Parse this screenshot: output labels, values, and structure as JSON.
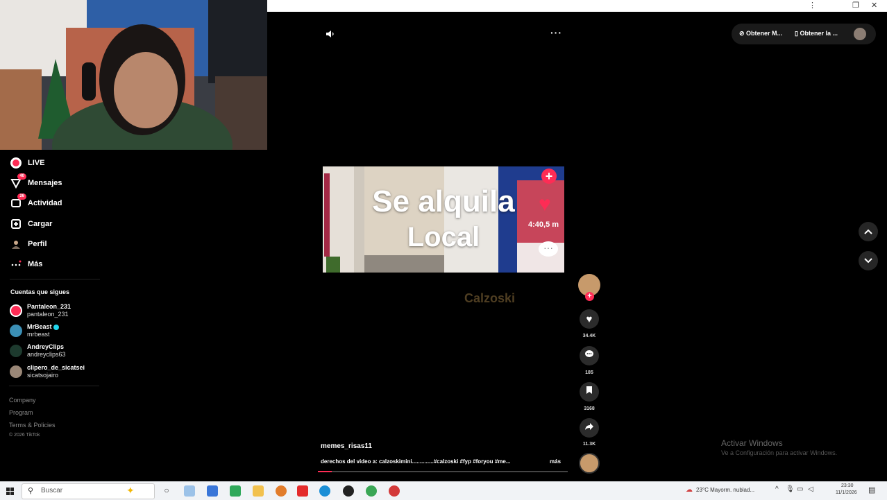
{
  "sidebar": {
    "nav": [
      {
        "label": "LIVE",
        "icon": "live-icon"
      },
      {
        "label": "Mensajes",
        "icon": "message-icon",
        "badge": "40"
      },
      {
        "label": "Actividad",
        "icon": "activity-icon",
        "badge": "26"
      },
      {
        "label": "Cargar",
        "icon": "upload-icon"
      },
      {
        "label": "Perfil",
        "icon": "profile-icon"
      },
      {
        "label": "Más",
        "icon": "more-icon"
      }
    ],
    "following_title": "Cuentas que sigues",
    "following": [
      {
        "name": "Pantaleon_231",
        "handle": "pantaleon_231"
      },
      {
        "name": "MrBeast",
        "handle": "mrbeast"
      },
      {
        "name": "AndreyClips",
        "handle": "andreyclips63"
      },
      {
        "name": "clipero_de_sicatsei",
        "handle": "sicatsojairo"
      }
    ],
    "footer": [
      "Company",
      "Program",
      "Terms & Policies",
      "© 2026 TikTok"
    ]
  },
  "header": {
    "get_app_1": "Obtener M...",
    "get_app_2": "Obtener la ..."
  },
  "video": {
    "caption_line1": "Se alquila",
    "caption_line2": "Local",
    "distance": "4:40,5 m",
    "watermark": "Calzoski",
    "author": "memes_risas11",
    "description": "derechos del video a: calzoskimini..............#calzoski #fyp #foryou #me...",
    "more_label": "más"
  },
  "actions": {
    "likes": "34.4K",
    "comments": "185",
    "saves": "3168",
    "shares": "11.3K"
  },
  "activation": {
    "title": "Activar Windows",
    "subtitle": "Ve a Configuración para activar Windows."
  },
  "taskbar": {
    "search_placeholder": "Buscar",
    "weather": "23°C  Mayorm. nublad...",
    "time": "23:30",
    "date": "11/1/2026"
  },
  "colors": {
    "accent": "#fe2c55",
    "background": "#000000"
  }
}
